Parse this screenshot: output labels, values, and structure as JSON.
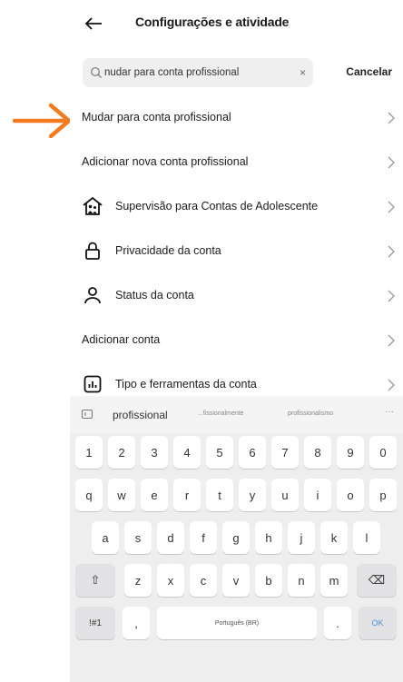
{
  "header": {
    "title": "Configurações e atividade",
    "back_icon": "arrow-left-icon"
  },
  "search": {
    "value": "nudar para conta profissional",
    "clear_label": "×",
    "cancel_label": "Cancelar"
  },
  "annotation": {
    "arrow_color": "#f47b20"
  },
  "results": [
    {
      "label": "Mudar para conta profissional",
      "icon": null
    },
    {
      "label": "Adicionar nova conta profissional",
      "icon": null
    },
    {
      "label": "Supervisão para Contas de Adolescente",
      "icon": "family-home-icon"
    },
    {
      "label": "Privacidade da conta",
      "icon": "lock-icon"
    },
    {
      "label": "Status da conta",
      "icon": "person-icon"
    },
    {
      "label": "Adicionar conta",
      "icon": null
    },
    {
      "label": "Tipo e ferramentas da conta",
      "icon": "chart-icon"
    }
  ],
  "keyboard": {
    "suggestions": {
      "main": "profissional",
      "second": "...fissionalmente",
      "third": "profissionalismo",
      "more": "···"
    },
    "row_numbers": [
      "1",
      "2",
      "3",
      "4",
      "5",
      "6",
      "7",
      "8",
      "9",
      "0"
    ],
    "row1": [
      "q",
      "w",
      "e",
      "r",
      "t",
      "y",
      "u",
      "i",
      "o",
      "p"
    ],
    "row2": [
      "a",
      "s",
      "d",
      "f",
      "g",
      "h",
      "j",
      "k",
      "l"
    ],
    "row3": [
      "z",
      "x",
      "c",
      "v",
      "b",
      "n",
      "m"
    ],
    "shift": "⇧",
    "backspace": "⌫",
    "symbols": "!#1",
    "comma": ",",
    "space": "Português (BR)",
    "period": ".",
    "ok": "OK"
  }
}
